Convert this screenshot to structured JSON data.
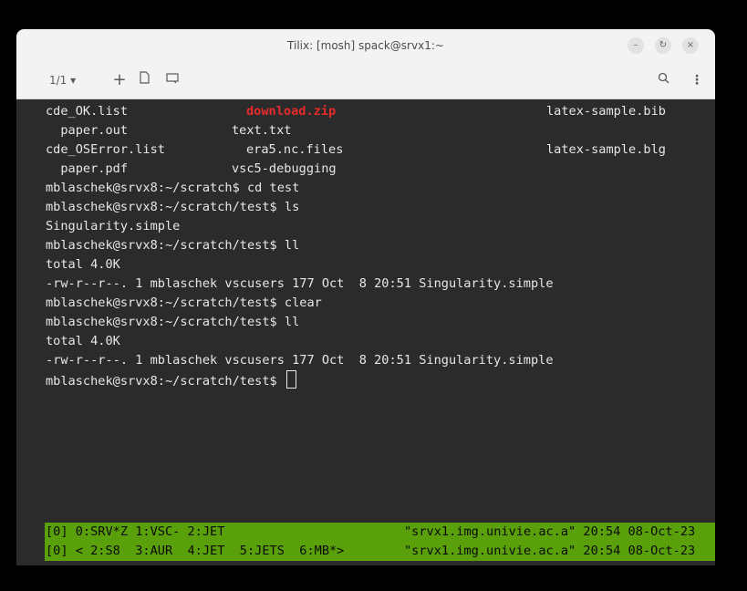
{
  "window": {
    "title": "Tilix: [mosh] spack@srvx1:~",
    "controls": [
      "–",
      "↻",
      "×"
    ]
  },
  "toolbar": {
    "session": "1/1 ▾",
    "icons": [
      "add-terminal-icon",
      "split-icon",
      "sidebar-icon",
      "search-icon",
      "more-menu-icon"
    ]
  },
  "terminal": {
    "lines": [
      {
        "a": "cde_OK.list",
        "b": "download.zip",
        "c": "latex-sample.bib"
      },
      {
        "a": "  paper.out",
        "b": "text.txt"
      },
      {
        "a": "cde_OSError.list",
        "b": "era5.nc.files",
        "c": "latex-sample.blg"
      },
      {
        "a": "  paper.pdf",
        "b": "vsc5-debugging"
      },
      {
        "t": "mblaschek@srvx8:~/scratch$ cd test"
      },
      {
        "t": "mblaschek@srvx8:~/scratch/test$ ls"
      },
      {
        "t": "Singularity.simple"
      },
      {
        "t": "mblaschek@srvx8:~/scratch/test$ ll"
      },
      {
        "t": "total 4.0K"
      },
      {
        "t": "-rw-r--r--. 1 mblaschek vscusers 177 Oct  8 20:51 Singularity.simple"
      },
      {
        "t": "mblaschek@srvx8:~/scratch/test$ clear"
      },
      {
        "t": "mblaschek@srvx8:~/scratch/test$ ll"
      },
      {
        "t": "total 4.0K"
      },
      {
        "t": "-rw-r--r--. 1 mblaschek vscusers 177 Oct  8 20:51 Singularity.simple"
      },
      {
        "t": "mblaschek@srvx8:~/scratch/test$ "
      }
    ],
    "highlight_color": "#e52b2b"
  },
  "statusbar": [
    {
      "left": "[0] 0:SRV*Z 1:VSC- 2:JET",
      "right": "\"srvx1.img.univie.ac.a\" 20:54 08-Oct-23"
    },
    {
      "left": "[0] < 2:S8  3:AUR  4:JET  5:JETS  6:MB*>",
      "right": "\"srvx1.img.univie.ac.a\" 20:54 08-Oct-23"
    }
  ],
  "colors": {
    "status_bg": "#5aa00b",
    "terminal_bg": "#2b2b2b",
    "titlebar_bg": "#f3f3f3"
  }
}
